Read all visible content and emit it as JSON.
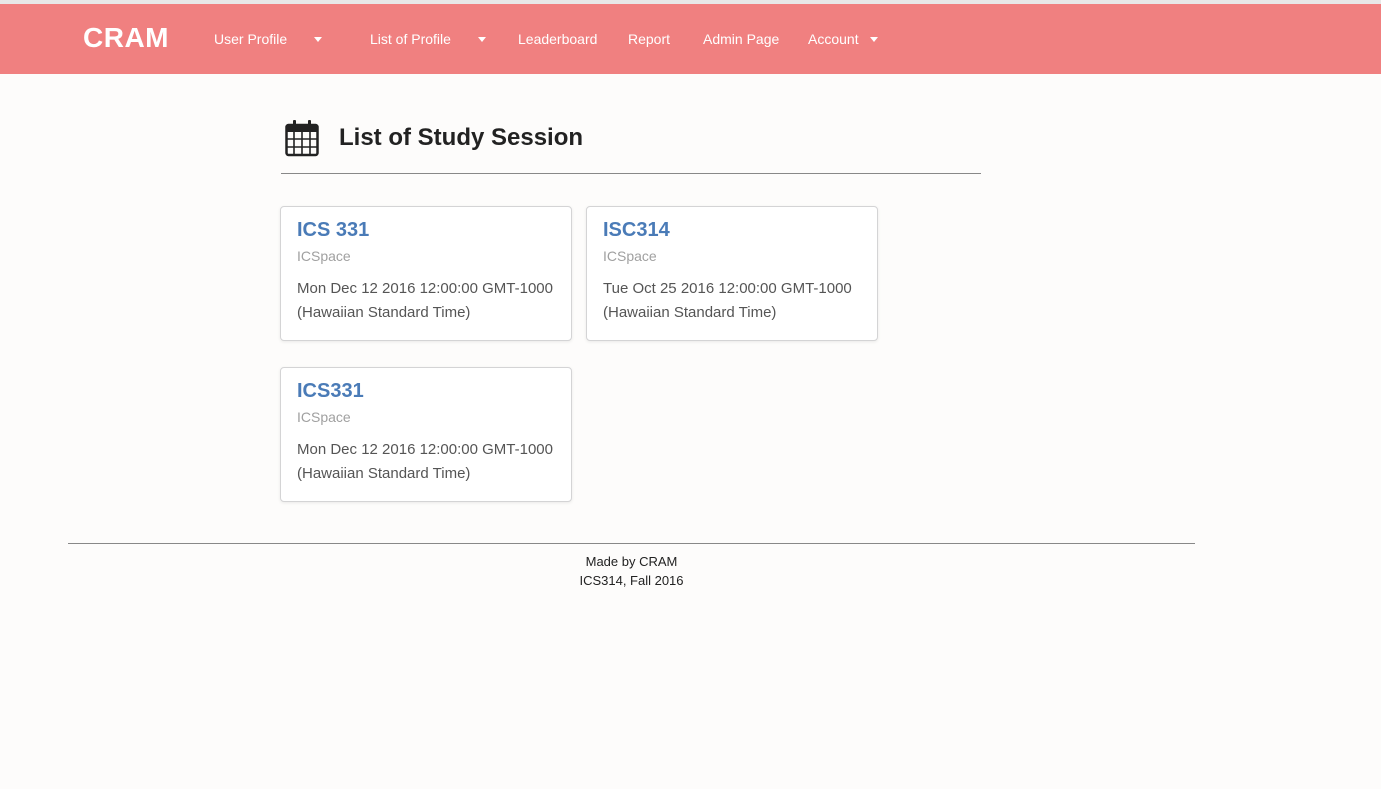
{
  "navbar": {
    "brand": "CRAM",
    "items": [
      {
        "label": "User Profile",
        "has_dropdown": true
      },
      {
        "label": "List of Profile",
        "has_dropdown": true
      },
      {
        "label": "Leaderboard",
        "has_dropdown": false
      },
      {
        "label": "Report",
        "has_dropdown": false
      },
      {
        "label": "Admin Page",
        "has_dropdown": false
      },
      {
        "label": "Account",
        "has_dropdown": true
      }
    ]
  },
  "main": {
    "title_icon": "calendar-icon",
    "title": "List of Study Session",
    "sessions": [
      {
        "course": "ICS 331",
        "location": "ICSpace",
        "date": "Mon Dec 12 2016 12:00:00 GMT-1000 (Hawaiian Standard Time)"
      },
      {
        "course": "ISC314",
        "location": "ICSpace",
        "date": "Tue Oct 25 2016 12:00:00 GMT-1000 (Hawaiian Standard Time)"
      },
      {
        "course": "ICS331",
        "location": "ICSpace",
        "date": "Mon Dec 12 2016 12:00:00 GMT-1000 (Hawaiian Standard Time)"
      }
    ]
  },
  "footer": {
    "line1": "Made by CRAM",
    "line2": "ICS314, Fall 2016"
  },
  "colors": {
    "navbar": "#f08080",
    "link": "#4a7bb7",
    "background": "#fdfcfb"
  }
}
